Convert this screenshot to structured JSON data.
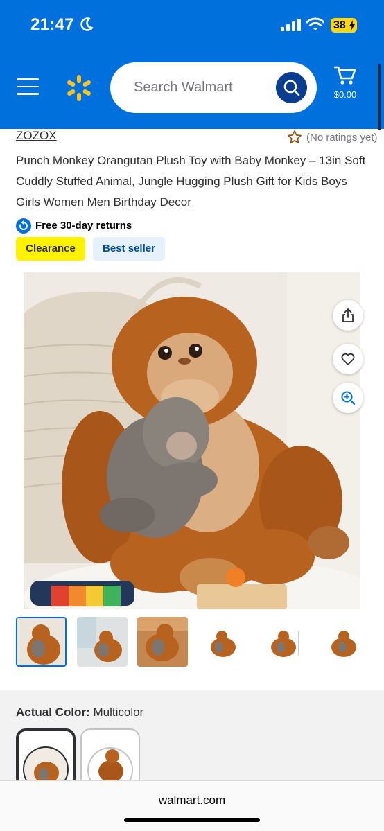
{
  "status_bar": {
    "time": "21:47",
    "battery": "38"
  },
  "header": {
    "search": {
      "placeholder": "Search Walmart"
    },
    "cart_total": "$0.00"
  },
  "product": {
    "brand": "ZOZOX",
    "rating_text": "(No ratings yet)",
    "title": "Punch Monkey Orangutan Plush Toy with Baby Monkey – 13in Soft Cuddly Stuffed Animal, Jungle Hugging Plush Gift for Kids Boys Girls Women Men Birthday Decor",
    "returns": "Free 30-day returns",
    "badges": [
      "Clearance",
      "Best seller"
    ]
  },
  "options": {
    "color_label": "Actual Color:",
    "color_value": "Multicolor"
  },
  "browser": {
    "url": "walmart.com"
  },
  "colors": {
    "walmart_blue": "#0071dc",
    "spark_yellow": "#ffc220",
    "clearance_yellow": "#fff200",
    "bestseller_bg": "#e6f1fc"
  },
  "icons": [
    "menu-icon",
    "walmart-spark-icon",
    "search-icon",
    "cart-icon",
    "star-icon",
    "returns-icon",
    "share-icon",
    "heart-icon",
    "zoom-icon"
  ]
}
